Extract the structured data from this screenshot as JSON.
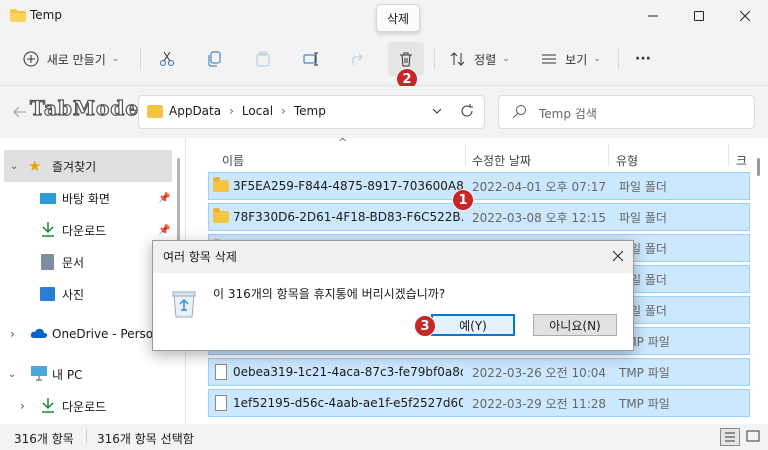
{
  "window": {
    "title": "Temp",
    "tooltip": "삭제"
  },
  "toolbar": {
    "new_label": "새로 만들기",
    "sort_label": "정렬",
    "view_label": "보기",
    "more": "···"
  },
  "address": {
    "crumbs": [
      "AppData",
      "Local",
      "Temp"
    ],
    "search_placeholder": "Temp 검색",
    "watermark": "TabMode.com"
  },
  "nav": {
    "favorites": "즐겨찾기",
    "items": [
      "바탕 화면",
      "다운로드",
      "문서",
      "사진"
    ],
    "onedrive": "OneDrive - Personal",
    "pc": "내 PC",
    "pc_items": [
      "다운로드"
    ]
  },
  "columns": {
    "name": "이름",
    "date": "수정한 날짜",
    "type": "유형",
    "size": "크"
  },
  "files": [
    {
      "name": "3F5EA259-F844-4875-8917-703600A8...",
      "date": "2022-04-01 오후 07:17",
      "type": "파일 폴더",
      "icon": "folder"
    },
    {
      "name": "78F330D6-2D61-4F18-BD83-F6C522B...",
      "date": "2022-03-08 오후 12:15",
      "type": "파일 폴더",
      "icon": "folder"
    },
    {
      "name": "",
      "date": "",
      "type": "파일 폴더",
      "icon": "folder"
    },
    {
      "name": "",
      "date": "",
      "type": "파일 폴더",
      "icon": "folder"
    },
    {
      "name": "",
      "date": "",
      "type": "파일 폴더",
      "icon": "folder"
    },
    {
      "name": "",
      "date": "",
      "type": "TMP 파일",
      "icon": "file"
    },
    {
      "name": "0ebea319-1c21-4aca-87c3-fe79bf0a8d...",
      "date": "2022-03-26 오전 10:04",
      "type": "TMP 파일",
      "icon": "file"
    },
    {
      "name": "1ef52195-d56c-4aab-ae1f-e5f2527d60...",
      "date": "2022-03-29 오전 11:28",
      "type": "TMP 파일",
      "icon": "file"
    }
  ],
  "status": {
    "count": "316개 항목",
    "selected": "316개 항목 선택함"
  },
  "dialog": {
    "title": "여러 항목 삭제",
    "message": "이 316개의 항목을 휴지통에 버리시겠습니까?",
    "yes": "예(Y)",
    "no": "아니요(N)"
  },
  "badges": [
    "1",
    "2",
    "3"
  ],
  "colors": {
    "selection": "#cce8ff",
    "badge": "#c62828",
    "accent": "#0078d7"
  }
}
